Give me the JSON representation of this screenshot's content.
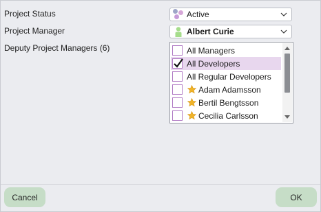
{
  "fields": {
    "project_status": {
      "label": "Project Status",
      "value": "Active",
      "icon": "status-dots-icon"
    },
    "project_manager": {
      "label": "Project Manager",
      "value": "Albert Curie",
      "icon": "person-icon"
    },
    "deputy_managers": {
      "label": "Deputy Project Managers (6)",
      "items": [
        {
          "label": "All Managers",
          "checked": false,
          "icon": null
        },
        {
          "label": "All Developers",
          "checked": true,
          "icon": null
        },
        {
          "label": "All Regular Developers",
          "checked": false,
          "icon": null
        },
        {
          "label": "Adam Adamsson",
          "checked": false,
          "icon": "star-icon"
        },
        {
          "label": "Bertil Bengtsson",
          "checked": false,
          "icon": "star-icon"
        },
        {
          "label": "Cecilia Carlsson",
          "checked": false,
          "icon": "star-icon"
        }
      ]
    }
  },
  "buttons": {
    "cancel": "Cancel",
    "ok": "OK"
  },
  "colors": {
    "background": "#ebecf0",
    "button": "#c6ddc7",
    "selection": "#e8d7ee",
    "checkbox_border": "#b07ac4",
    "star": "#f0b429",
    "person": "#a6dd8c"
  }
}
